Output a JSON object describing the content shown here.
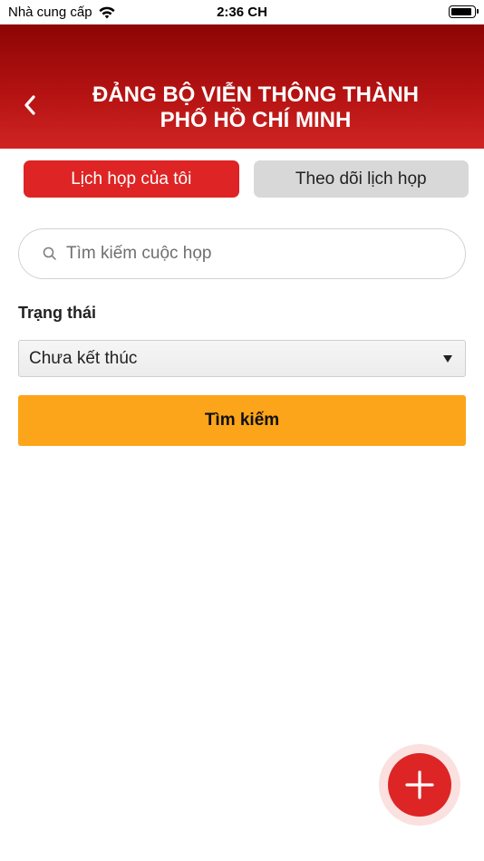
{
  "status_bar": {
    "carrier": "Nhà cung cấp",
    "time": "2:36 CH",
    "wifi_icon": "wifi-icon",
    "battery_icon": "battery-icon"
  },
  "header": {
    "title_line1": "ĐẢNG BỘ VIỄN THÔNG THÀNH",
    "title_line2": "PHỐ HỒ CHÍ MINH",
    "back_icon": "chevron-left-icon",
    "background_color": "#b41212"
  },
  "tabs": [
    {
      "label": "Lịch họp của tôi",
      "active": true
    },
    {
      "label": "Theo dõi lịch họp",
      "active": false
    }
  ],
  "search": {
    "placeholder": "Tìm kiếm cuộc họp",
    "value": "",
    "icon": "search-icon"
  },
  "filter": {
    "label": "Trạng thái",
    "selected": "Chưa kết thúc"
  },
  "search_button": {
    "label": "Tìm kiếm",
    "color": "#fca51a"
  },
  "fab": {
    "icon": "plus-icon",
    "color": "#dd2525"
  }
}
